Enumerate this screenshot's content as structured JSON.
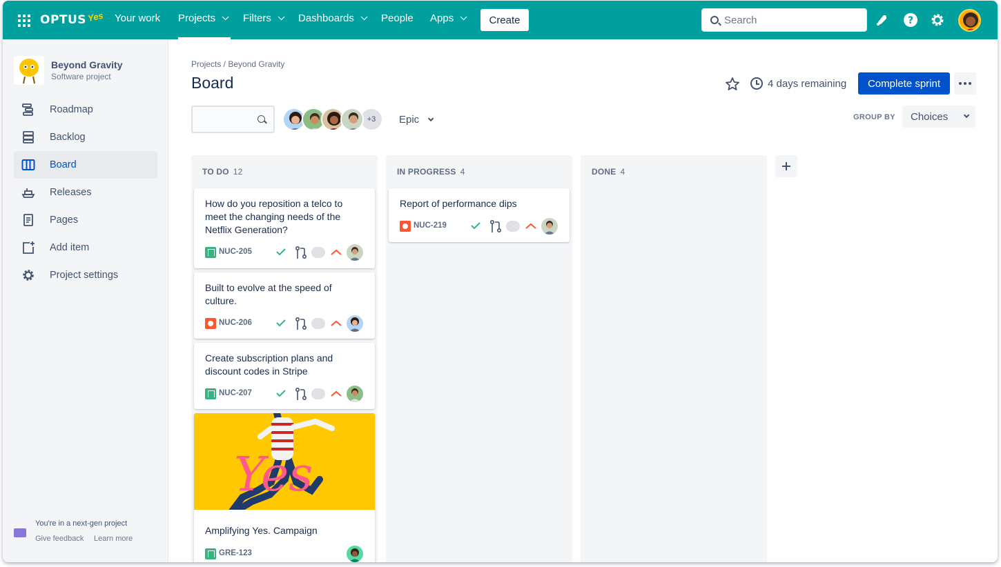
{
  "nav": {
    "brand": "OPTUS",
    "brand_tag": "Yes",
    "items": [
      {
        "label": "Your work"
      },
      {
        "label": "Projects"
      },
      {
        "label": "Filters"
      },
      {
        "label": "Dashboards"
      },
      {
        "label": "People"
      },
      {
        "label": "Apps"
      }
    ],
    "create_label": "Create",
    "search_placeholder": "Search"
  },
  "sidebar": {
    "project_name": "Beyond Gravity",
    "project_type": "Software project",
    "items": [
      {
        "label": "Roadmap",
        "icon": "roadmap-icon"
      },
      {
        "label": "Backlog",
        "icon": "backlog-icon"
      },
      {
        "label": "Board",
        "icon": "board-icon",
        "active": true
      },
      {
        "label": "Releases",
        "icon": "releases-icon"
      },
      {
        "label": "Pages",
        "icon": "pages-icon"
      },
      {
        "label": "Add item",
        "icon": "add-item-icon"
      },
      {
        "label": "Project settings",
        "icon": "gear-icon"
      }
    ],
    "footer": {
      "title": "You're in a next-gen project",
      "feedback": "Give feedback",
      "learn_more": "Learn more"
    }
  },
  "main": {
    "breadcrumb": "Projects / Beyond Gravity",
    "title": "Board",
    "remaining": "4 days remaining",
    "complete_label": "Complete sprint",
    "avatars_more": "+3",
    "epic_label": "Epic",
    "group_by_label": "GROUP BY",
    "group_by_value": "Choices"
  },
  "columns": [
    {
      "name": "TO DO",
      "count": "12",
      "cards": [
        {
          "title": "How do you reposition a telco to meet the changing needs of the Netflix Generation?",
          "key": "NUC-205",
          "type": "story"
        },
        {
          "title": "Built to evolve at the speed of culture.",
          "key": "NUC-206",
          "type": "bug"
        },
        {
          "title": "Create subscription plans and discount codes in Stripe",
          "key": "NUC-207",
          "type": "story"
        },
        {
          "title": "Amplifying Yes. Campaign",
          "key": "GRE-123",
          "type": "story",
          "image_text": "Yes"
        }
      ]
    },
    {
      "name": "IN PROGRESS",
      "count": "4",
      "cards": [
        {
          "title": "Report of performance dips",
          "key": "NUC-219",
          "type": "bug"
        }
      ]
    },
    {
      "name": "DONE",
      "count": "4",
      "cards": []
    }
  ],
  "colors": {
    "nav_bg": "#00a09e",
    "primary": "#0052cc",
    "story": "#36b37e",
    "bug": "#ff5630",
    "priority": "#ff5630",
    "done_check": "#36b37e",
    "card_image_bg": "#ffc800"
  }
}
